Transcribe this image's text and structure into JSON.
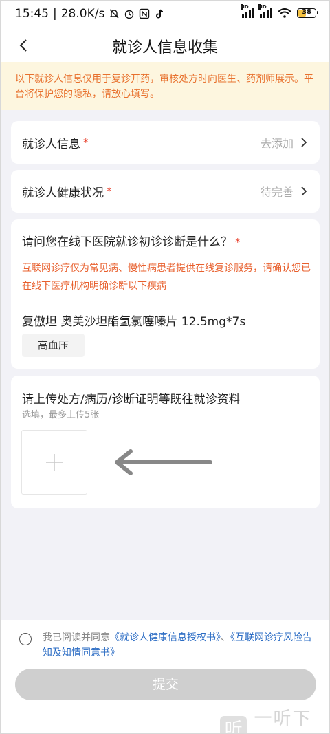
{
  "status_bar": {
    "time": "15:45",
    "speed": "28.0K/s",
    "battery": "38",
    "icons": [
      "mute-bell-icon",
      "alarm-icon",
      "nfc-icon",
      "tiktok-icon",
      "signal-icon",
      "signal-icon",
      "wifi-icon",
      "battery-icon"
    ]
  },
  "nav": {
    "title": "就诊人信息收集",
    "back_icon": "chevron-left-icon"
  },
  "notice": {
    "text": "以下就诊人信息仅用于复诊开药，审核处方时向医生、药剂师展示。平台将保护您的隐私，请放心填写。"
  },
  "patient_info": {
    "label": "就诊人信息",
    "required_mark": "*",
    "value": "去添加"
  },
  "health_status": {
    "label": "就诊人健康状况",
    "required_mark": "*",
    "value": "待完善"
  },
  "diagnosis": {
    "question": "请问您在线下医院就诊初诊诊断是什么？",
    "required_mark": "*",
    "note": "互联网诊疗仅为常见病、慢性病患者提供在线复诊服务，请确认您已在线下医疗机构明确诊断以下疾病",
    "drug": "复傲坦 奥美沙坦酯氢氯噻嗪片 12.5mg*7s",
    "tag": "高血压"
  },
  "upload": {
    "title": "请上传处方/病历/诊断证明等既往就诊资料",
    "subtitle": "选填，最多上传5张"
  },
  "agreement": {
    "prefix": "我已阅读并同意",
    "link1": "《就诊人健康信息授权书》",
    "sep": "、",
    "link2": "《互联网诊疗风险告知及知情同意书》"
  },
  "submit_label": "提交",
  "watermark": {
    "logo_char": "听",
    "text": "一听下载"
  },
  "colors": {
    "accent_orange": "#e8712e",
    "required_red": "#e8412e",
    "link_blue": "#2b6cc4",
    "notice_bg": "#fdf6df",
    "disabled_button": "#cfcfcf"
  }
}
